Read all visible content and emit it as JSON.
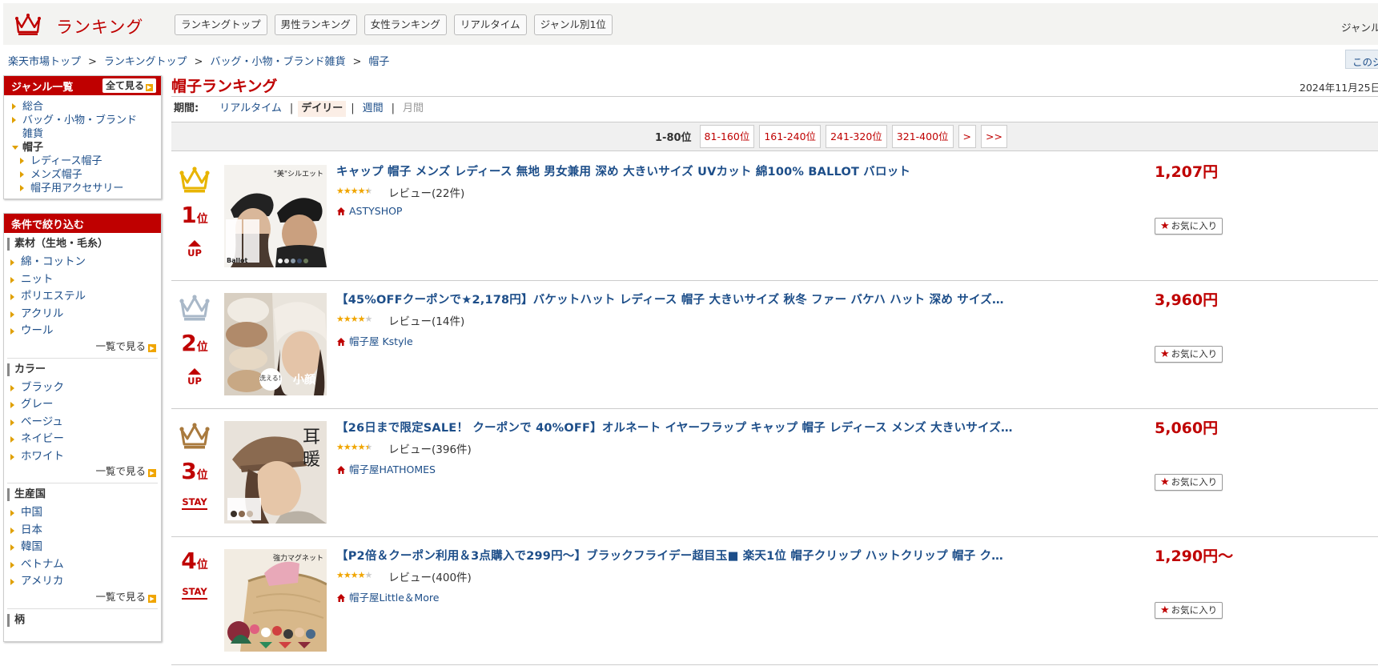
{
  "header": {
    "logo_text": "ランキング",
    "nav": [
      "ランキングトップ",
      "男性ランキング",
      "女性ランキング",
      "リアルタイム",
      "ジャンル別1位"
    ],
    "genre_partial": "ジャンル"
  },
  "breadcrumb": [
    "楽天市場トップ",
    "ランキングトップ",
    "バッグ・小物・ブランド雑貨",
    "帽子"
  ],
  "breadcrumb_sep": ">",
  "right_tab": "このジ",
  "sidebar": {
    "genre_title": "ジャンル一覧",
    "see_all": "全て見る",
    "genres": [
      {
        "label": "総合",
        "type": "top"
      },
      {
        "label": "バッグ・小物・ブランド",
        "type": "top"
      },
      {
        "label": "雑貨",
        "type": "cont"
      },
      {
        "label": "帽子",
        "type": "cur"
      },
      {
        "label": "レディース帽子",
        "type": "sub"
      },
      {
        "label": "メンズ帽子",
        "type": "sub"
      },
      {
        "label": "帽子用アクセサリー",
        "type": "sub"
      }
    ],
    "filter_title": "条件で絞り込む",
    "filters": [
      {
        "title": "素材（生地・毛糸）",
        "items": [
          "綿・コットン",
          "ニット",
          "ポリエステル",
          "アクリル",
          "ウール"
        ],
        "more": "一覧で見る"
      },
      {
        "title": "カラー",
        "items": [
          "ブラック",
          "グレー",
          "ベージュ",
          "ネイビー",
          "ホワイト"
        ],
        "more": "一覧で見る"
      },
      {
        "title": "生産国",
        "items": [
          "中国",
          "日本",
          "韓国",
          "ベトナム",
          "アメリカ"
        ],
        "more": "一覧で見る"
      },
      {
        "title": "柄",
        "items": [],
        "more": ""
      }
    ]
  },
  "main": {
    "title": "帽子ランキング",
    "date": "2024年11月25日(",
    "period_label": "期間:",
    "periods": [
      {
        "label": "リアルタイム",
        "state": "link"
      },
      {
        "label": "デイリー",
        "state": "active"
      },
      {
        "label": "週間",
        "state": "link"
      },
      {
        "label": "月間",
        "state": "disabled"
      }
    ],
    "pager": {
      "current": "1-80位",
      "pages": [
        "81-160位",
        "161-240位",
        "241-320位",
        "321-400位",
        ">",
        ">>"
      ]
    }
  },
  "items": [
    {
      "rank": "1",
      "rank_unit": "位",
      "trend": "UP",
      "crown": "gold",
      "title": "キャップ 帽子 メンズ レディース 無地 男女兼用 深め 大きいサイズ UVカット 綿100% BALLOT バロット",
      "rating": 4.5,
      "review": "レビュー(22件)",
      "shop": "ASTYSHOP",
      "price": "1,207円",
      "fav": "お気に入り",
      "thumb_text": "\"美\"シルエット",
      "thumb_text2": "Ballot"
    },
    {
      "rank": "2",
      "rank_unit": "位",
      "trend": "UP",
      "crown": "silver",
      "title": "【45%OFFクーポンで★2,178円】バケットハット レディース 帽子 大きいサイズ 秋冬 ファー バケハ ハット 深め サイズ…",
      "rating": 4,
      "review": "レビュー(14件)",
      "shop": "帽子屋 Kstyle",
      "price": "3,960円",
      "fav": "お気に入り",
      "thumb_text": "洗える!",
      "thumb_text2": "小顔"
    },
    {
      "rank": "3",
      "rank_unit": "位",
      "trend": "STAY",
      "crown": "bronze",
      "title": "【26日まで限定SALE！ クーポンで 40%OFF】オルネート イヤーフラップ キャップ 帽子 レディース メンズ 大きいサイズ…",
      "rating": 4.5,
      "review": "レビュー(396件)",
      "shop": "帽子屋HATHOMES",
      "price": "5,060円",
      "fav": "お気に入り",
      "thumb_text": "耳",
      "thumb_text2": "暖"
    },
    {
      "rank": "4",
      "rank_unit": "位",
      "trend": "STAY",
      "crown": "none",
      "title": "【P2倍＆クーポン利用＆3点購入で299円～】ブラックフライデー超目玉■ 楽天1位 帽子クリップ ハットクリップ 帽子 ク…",
      "rating": 4,
      "review": "レビュー(400件)",
      "shop": "帽子屋Little＆More",
      "price": "1,290円～",
      "fav": "お気に入り",
      "thumb_text": "強力マグネット",
      "thumb_text2": ""
    }
  ],
  "colors": {
    "brand_red": "#bf0000",
    "link_blue": "#1d4e89",
    "star": "#f0a500",
    "gold": "#e8b400",
    "silver": "#a9b8c8",
    "bronze": "#a97a3e"
  }
}
